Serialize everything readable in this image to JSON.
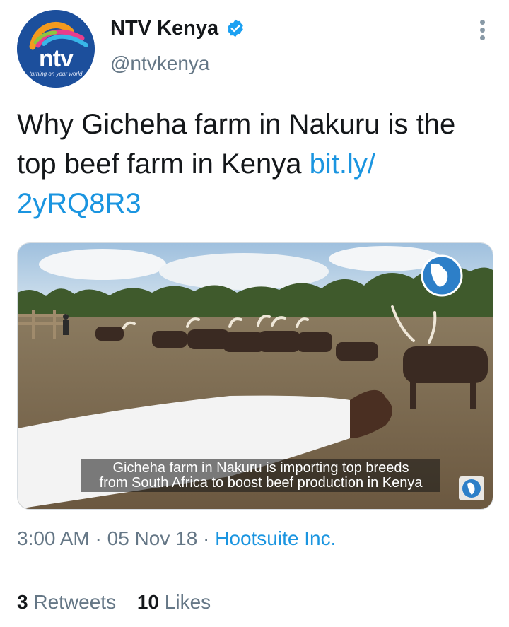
{
  "account": {
    "display_name": "NTV Kenya",
    "handle": "@ntvkenya",
    "verified_icon": "verified-badge-icon",
    "avatar_logo_text": "ntv",
    "avatar_slogan": "turning on your world"
  },
  "tweet": {
    "text": "Why Gicheha farm in Nakuru is the top beef farm in Kenya ",
    "link_line1": "bit.ly/",
    "link_line2": "2yRQ8R3"
  },
  "media": {
    "caption_line1": "Gicheha farm in Nakuru is importing top breeds",
    "caption_line2": "from South Africa to boost beef production in Kenya"
  },
  "meta": {
    "time": "3:00 AM",
    "separator": " · ",
    "date": "05 Nov 18",
    "source": "Hootsuite Inc."
  },
  "stats": {
    "retweets_count": "3",
    "retweets_label": "Retweets",
    "likes_count": "10",
    "likes_label": "Likes"
  },
  "colors": {
    "link": "#1b95e0",
    "secondary_text": "#657786",
    "brand_blue": "#1c4f9c"
  }
}
